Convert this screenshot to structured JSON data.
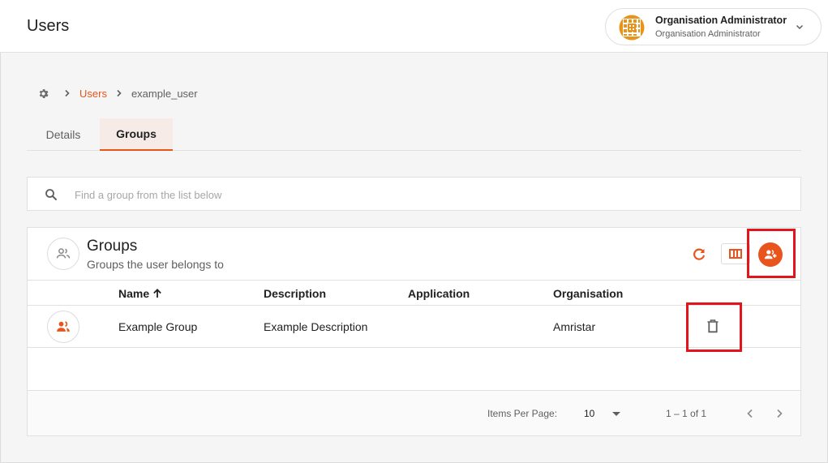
{
  "app": {
    "title": "Users"
  },
  "user": {
    "name": "Organisation Administrator",
    "role": "Organisation Administrator"
  },
  "breadcrumb": {
    "home_icon": "gear-icon",
    "parent": "Users",
    "current": "example_user"
  },
  "tabs": [
    {
      "label": "Details",
      "active": false
    },
    {
      "label": "Groups",
      "active": true
    }
  ],
  "search": {
    "placeholder": "Find a group from the list below",
    "value": ""
  },
  "card": {
    "title": "Groups",
    "subtitle": "Groups the user belongs to",
    "actions": [
      "refresh-icon",
      "columns-icon",
      "add-group-icon"
    ]
  },
  "table": {
    "columns": [
      "Name",
      "Description",
      "Application",
      "Organisation"
    ],
    "sort": {
      "column": "Name",
      "direction": "ascending"
    },
    "rows": [
      {
        "name": "Example Group",
        "description": "Example Description",
        "application": "",
        "organisation": "Amristar"
      }
    ]
  },
  "paginator": {
    "items_per_page_label": "Items Per Page:",
    "items_per_page": "10",
    "range": "1 – 1 of 1"
  },
  "colors": {
    "accent": "#e8541c",
    "highlight": "#e3151a",
    "tab_active_bg": "#f6ebe6"
  }
}
